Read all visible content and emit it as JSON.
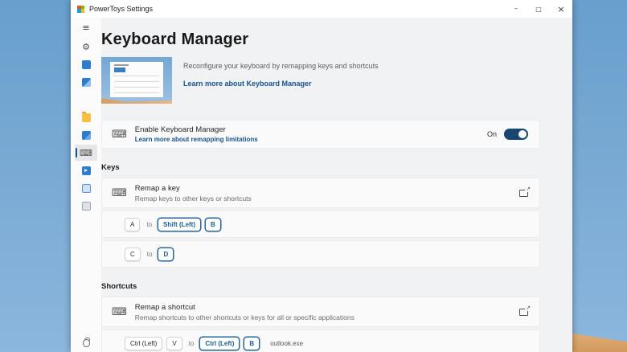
{
  "colors": {
    "accent": "#17538c",
    "toggle_on": "#17466e",
    "sky_top": "#689fcc",
    "sky_bottom": "#8cb6dd",
    "module_blue": "#2e7cd0",
    "folder_yellow": "#f7c13d"
  },
  "titlebar": {
    "title": "PowerToys Settings",
    "minimize_icon": "–",
    "maximize_icon": "□",
    "close_icon": "×"
  },
  "icons": {
    "hamburger": "≡",
    "gear": "⚙",
    "keyboard": "⌨"
  },
  "sidebar": {
    "items": [
      {
        "name": "general"
      },
      {
        "name": "awake"
      },
      {
        "name": "color-picker"
      },
      {
        "name": "fancyzones"
      },
      {
        "name": "file-explorer"
      },
      {
        "name": "image-resizer"
      },
      {
        "name": "keyboard-manager",
        "selected": true
      },
      {
        "name": "power-rename"
      },
      {
        "name": "powertoys-run"
      },
      {
        "name": "shortcut-guide"
      }
    ]
  },
  "header": {
    "title": "Keyboard Manager",
    "description": "Reconfigure your keyboard by remapping keys and shortcuts",
    "learn_more": "Learn more about Keyboard Manager"
  },
  "enable": {
    "title": "Enable Keyboard Manager",
    "link": "Learn more about remapping limitations",
    "toggle_label": "On",
    "toggle_state": "on"
  },
  "keys": {
    "section": "Keys",
    "card_title": "Remap a key",
    "card_subtitle": "Remap keys to other keys or shortcuts",
    "to_label": "to",
    "rows": [
      {
        "from": [
          "A"
        ],
        "to": [
          "Shift (Left)",
          "B"
        ]
      },
      {
        "from": [
          "C"
        ],
        "to": [
          "D"
        ]
      }
    ]
  },
  "shortcuts": {
    "section": "Shortcuts",
    "card_title": "Remap a shortcut",
    "card_subtitle": "Remap shortcuts to other shortcuts or keys for all or specific applications",
    "to_label": "to",
    "rows": [
      {
        "from": [
          "Ctrl (Left)",
          "V"
        ],
        "to": [
          "Ctrl (Left)",
          "B"
        ],
        "app": "outlook.exe"
      }
    ]
  }
}
